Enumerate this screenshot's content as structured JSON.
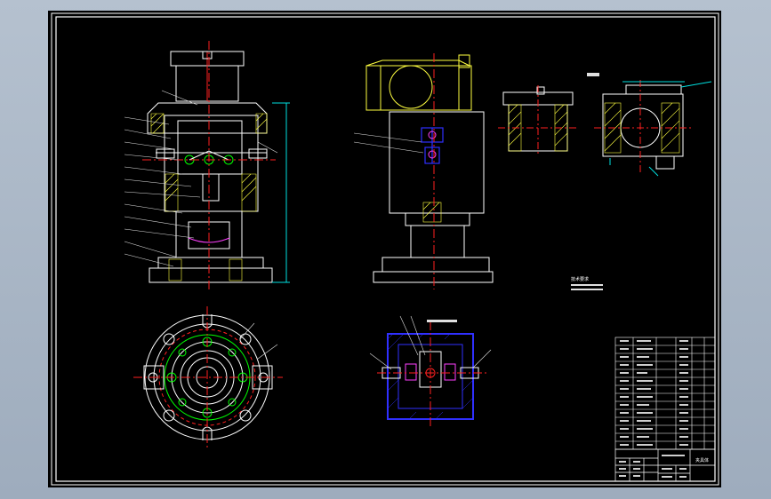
{
  "drawing": {
    "colors": {
      "background": "#000000",
      "frame": "#ffffff",
      "outline": "#ffffff",
      "centerline": "#ff2020",
      "dimension": "#00e0e0",
      "hatch": "#ffff40",
      "part_green": "#00ff00",
      "part_blue": "#3030ff",
      "part_magenta": "#ff40ff",
      "leader": "#e0e0e0"
    },
    "tech_note_title": "技术要求",
    "title_block_name": "夹具体"
  }
}
